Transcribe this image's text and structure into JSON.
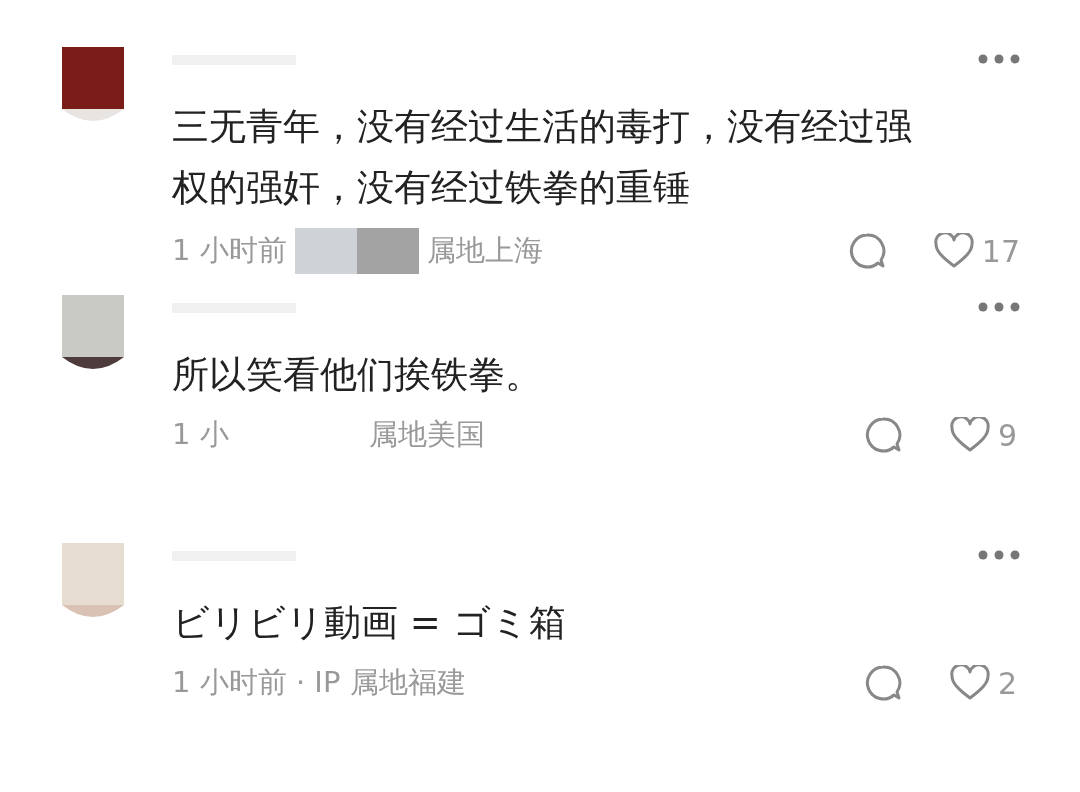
{
  "comments": [
    {
      "text": "三无青年，没有经过生活的毒打，没有经过强权的强奸，没有经过铁拳的重锤",
      "meta": [
        "1 小时前",
        "属地上海"
      ],
      "meta_redacted": true,
      "likes": "17"
    },
    {
      "text": "所以笑看他们挨铁拳。",
      "meta": [
        "1 小",
        "属地美国"
      ],
      "meta_redacted": false,
      "likes": "9"
    },
    {
      "text": "ビリビリ動画 = ゴミ箱",
      "meta": [
        "1 小时前 · IP 属地福建"
      ],
      "likes": "2"
    }
  ]
}
